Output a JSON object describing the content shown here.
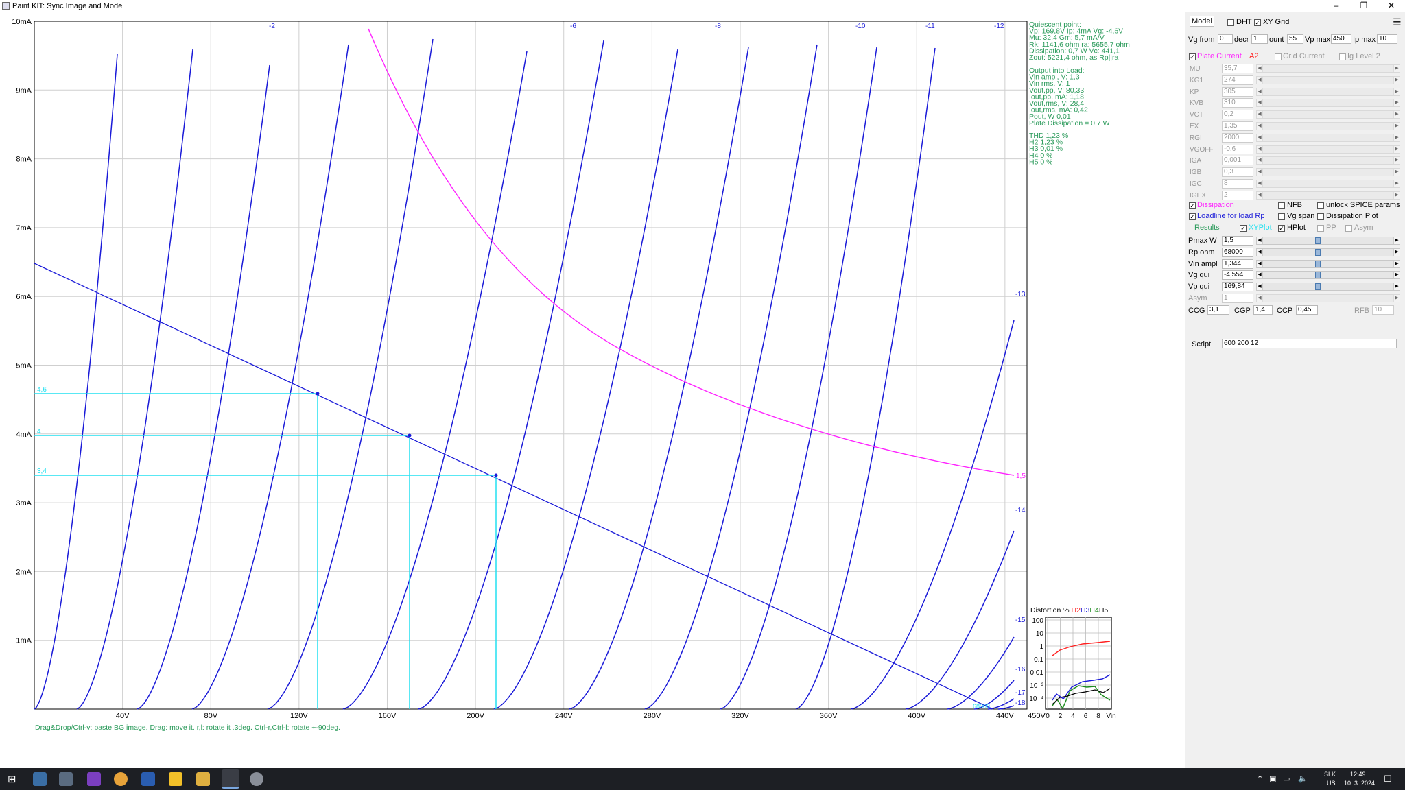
{
  "window": {
    "title": "Paint KIT: Sync Image and Model",
    "min": "–",
    "restore": "❐",
    "close": "✕"
  },
  "plot": {
    "y_ticks": [
      "10mA",
      "9mA",
      "8mA",
      "7mA",
      "6mA",
      "5mA",
      "4mA",
      "3mA",
      "2mA",
      "1mA"
    ],
    "x_ticks": [
      "40V",
      "80V",
      "120V",
      "160V",
      "200V",
      "240V",
      "280V",
      "320V",
      "360V",
      "400V",
      "440V",
      "450V"
    ],
    "curve_labels_top": [
      "-2",
      "-6",
      "-8",
      "-10",
      "-11",
      "-12"
    ],
    "curve_labels_right": [
      "-13",
      "-14",
      "-15",
      "-16",
      "-17",
      "-18"
    ],
    "pmax_label": "1,5",
    "loadline_values": [
      "4,6",
      "4",
      "3,4"
    ],
    "help_text": "Drag&Drop/Ctrl-v: paste BG image. Drag: move it. r,l: rotate it .3deg. Ctrl-r,Ctrl-l: rotate +-90deg.",
    "rp_overlay": "68000",
    "info_quiescent": [
      "Quiescent point:",
      "Vp: 169,8V  Ip: 4mA  Vg: -4,6V",
      "Mu: 32,4 Gm: 5,7 mA/V",
      "Rk: 1141,6 ohm ra: 5655,7 ohm",
      "Dissipation: 0,7 W Vc: 441,1",
      "Zout: 5221,4 ohm, as Rp||ra"
    ],
    "info_output": [
      "Output into Load:",
      "Vin ampl, V: 1,3",
      "Vin rms, V: 1",
      "Vout,pp, V: 80,33",
      "Iout,pp, mA: 1,18",
      "Vout,rms, V: 28,4",
      "Iout,rms, mA: 0,42",
      "Pout, W      0,01",
      "Plate Dissipation = 0,7 W"
    ],
    "info_thd": [
      "THD 1,23 %",
      " H2 1,23 %",
      " H3 0,01 %",
      " H4 0 %",
      " H5 0 %"
    ],
    "distortion": {
      "title": "Distortion % ",
      "h2": "H2",
      "h3": "H3",
      "h4": "H4",
      "h5": "H5",
      "y_ticks": [
        "100",
        "10",
        "1",
        "0.1",
        "0.01",
        "10⁻³",
        "10⁻⁴"
      ],
      "x_ticks": [
        "0",
        "2",
        "4",
        "6",
        "8",
        "Vin"
      ]
    },
    "colors": {
      "curves": "#1a1ad8",
      "dissipation": "#ff22ff",
      "cursor": "#22e0f0",
      "info": "#2a9a5a",
      "grid": "#cccccc"
    }
  },
  "panel": {
    "model_tab": "Model",
    "dht": "DHT",
    "xy_grid": "XY Grid",
    "vg_from_label": "Vg from",
    "vg_from": "0",
    "decr_label": "decr",
    "decr": "1",
    "count_label": "ount",
    "count": "55",
    "vp_max_label": "Vp max",
    "vp_max": "450",
    "ip_max_label": "Ip max",
    "ip_max": "10",
    "plate_current": "Plate Current",
    "a2": "A2",
    "grid_current": "Grid Current",
    "ig_level2": "Ig Level 2",
    "params": [
      {
        "name": "MU",
        "value": "35,7"
      },
      {
        "name": "KG1",
        "value": "274"
      },
      {
        "name": "KP",
        "value": "305"
      },
      {
        "name": "KVB",
        "value": "310"
      },
      {
        "name": "VCT",
        "value": "0,2"
      },
      {
        "name": "EX",
        "value": "1,35"
      },
      {
        "name": "RGI",
        "value": "2000"
      },
      {
        "name": "VGOFF",
        "value": "-0,6"
      },
      {
        "name": "IGA",
        "value": "0,001"
      },
      {
        "name": "IGB",
        "value": "0,3"
      },
      {
        "name": "IGC",
        "value": "8"
      },
      {
        "name": "IGEX",
        "value": "2"
      }
    ],
    "dissipation": "Dissipation",
    "nfb": "NFB",
    "unlock": "unlock SPICE params",
    "loadline": "Loadline for load Rp",
    "vg_span": "Vg span",
    "dissipation_plot": "Dissipation Plot",
    "results": "Results",
    "xyplot": "XYPlot",
    "hplot": "HPlot",
    "pp": "PP",
    "asym": "Asym",
    "sliders": [
      {
        "name": "Pmax W",
        "value": "1,5"
      },
      {
        "name": "Rp ohm",
        "value": "68000"
      },
      {
        "name": "Vin ampl",
        "value": "1,344"
      },
      {
        "name": "Vg qui",
        "value": "-4,554"
      },
      {
        "name": "Vp qui",
        "value": "169,84"
      },
      {
        "name": "Asym",
        "value": "1"
      }
    ],
    "ccg_label": "CCG",
    "ccg": "3,1",
    "cgp_label": "CGP",
    "cgp": "1,4",
    "ccp_label": "CCP",
    "ccp": "0,45",
    "rfb_label": "RFB",
    "rfb": "10",
    "script_label": "Script",
    "script": "600 200 12"
  },
  "taskbar": {
    "lang": "SLK",
    "layout": "US",
    "time": "12:49",
    "date": "10. 3. 2024"
  }
}
